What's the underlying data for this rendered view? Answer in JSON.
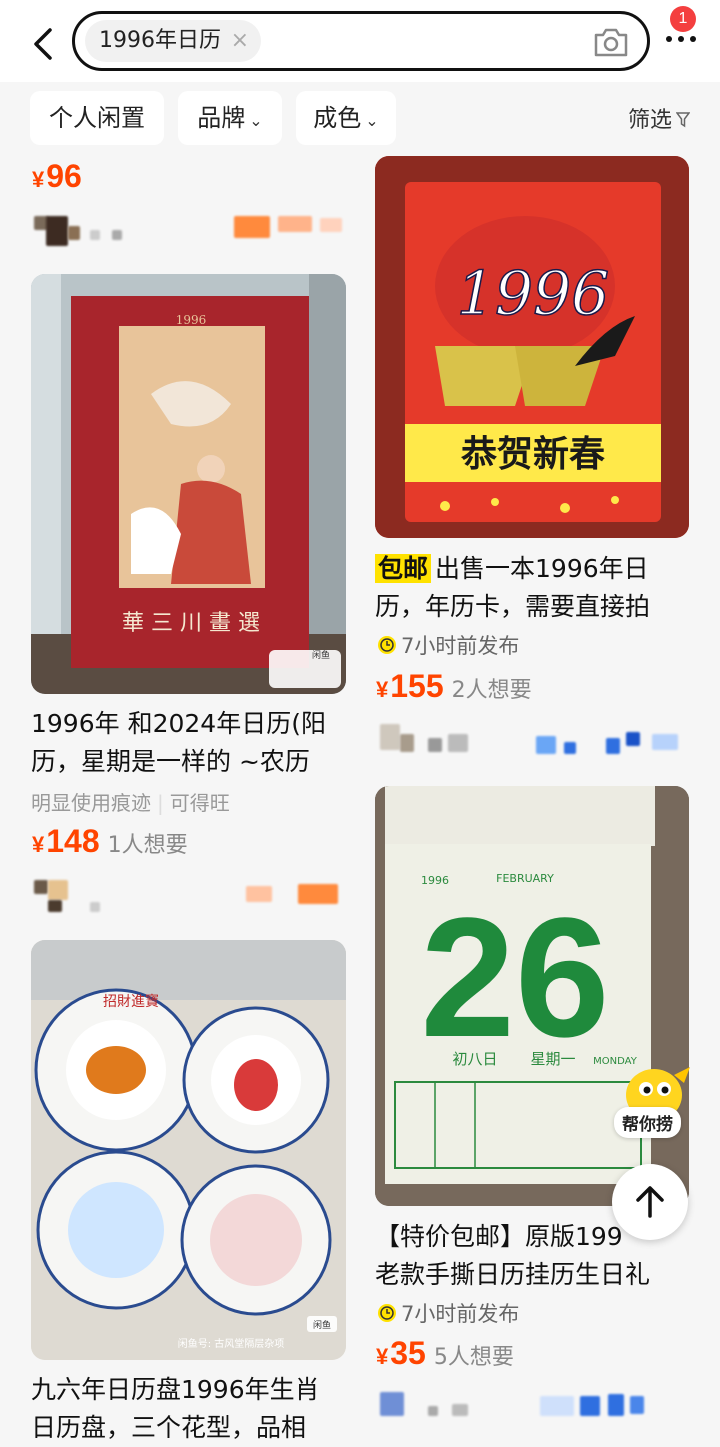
{
  "search": {
    "query": "1996年日历",
    "clear": "×"
  },
  "notifications": {
    "count": "1"
  },
  "filters": {
    "items": [
      "个人闲置",
      "品牌",
      "成色"
    ],
    "caret": "⌄",
    "filter_label": "筛选"
  },
  "left_col": {
    "top_price": "96",
    "card1": {
      "title_line1": "1996年 和2024年日历(阳",
      "title_line2": "历，星期是一样的 ~农历",
      "meta_a": "明显使用痕迹",
      "meta_b": "可得旺",
      "price": "148",
      "want": "1人想要",
      "img_year": "1996",
      "img_caption": "華 三 川 畫 選",
      "img_tag": "闲鱼"
    },
    "card2": {
      "title_line1": "九六年日历盘1996年生肖",
      "title_line2": "日历盘，三个花型，品相",
      "img_tag": "闲鱼",
      "img_watermark": "闲鱼号: 古风堂隔层杂项",
      "plate_text": "招財進寶"
    }
  },
  "right_col": {
    "card1": {
      "badge": "包邮",
      "title_line1": "出售一本1996年日",
      "title_line2": "历，年历卡，需要直接拍",
      "time": "7小时前发布",
      "price": "155",
      "want": "2人想要",
      "img_year": "1996",
      "img_banner": "恭贺新春"
    },
    "card2": {
      "title_line1": "【特价包邮】原版199",
      "title_line2": "老款手撕日历挂历生日礼",
      "time": "7小时前发布",
      "price": "35",
      "want": "5人想要",
      "img_day": "26",
      "img_month": "FEBRUARY",
      "img_year": "1996",
      "img_lunar": "初八日",
      "img_weekday": "星期一",
      "img_weekday_en": "MONDAY"
    }
  },
  "currency": "¥",
  "floating": {
    "mascot_label": "帮你捞"
  },
  "colors": {
    "price": "#ff4400",
    "badge_yellow": "#ffe200",
    "notif_red": "#f43f3f"
  }
}
